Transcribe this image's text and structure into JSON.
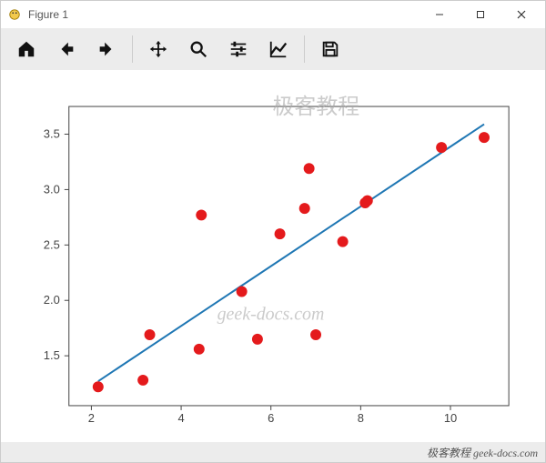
{
  "window": {
    "title": "Figure 1"
  },
  "toolbar": {
    "home": "Home",
    "back": "Back",
    "forward": "Forward",
    "pan": "Pan",
    "zoom": "Zoom",
    "configure": "Configure subplots",
    "edit": "Edit axes",
    "save": "Save"
  },
  "watermarks": {
    "top": "极客教程",
    "mid": "geek-docs.com"
  },
  "status": {
    "text": "极客教程 geek-docs.com"
  },
  "chart_data": {
    "type": "scatter",
    "title": "",
    "xlabel": "",
    "ylabel": "",
    "xlim": [
      1.5,
      11.3
    ],
    "ylim": [
      1.05,
      3.75
    ],
    "xticks": [
      2,
      4,
      6,
      8,
      10
    ],
    "yticks": [
      1.5,
      2.0,
      2.5,
      3.0,
      3.5
    ],
    "series": [
      {
        "name": "points",
        "type": "scatter",
        "color": "#e41a1c",
        "x": [
          2.15,
          3.15,
          3.3,
          4.4,
          4.45,
          5.35,
          5.7,
          6.2,
          6.75,
          6.85,
          7.0,
          7.6,
          8.1,
          8.15,
          9.8,
          10.75
        ],
        "y": [
          1.22,
          1.28,
          1.69,
          1.56,
          2.77,
          2.08,
          1.65,
          2.6,
          2.83,
          3.19,
          1.69,
          2.53,
          2.88,
          2.9,
          3.38,
          3.47
        ]
      },
      {
        "name": "fit",
        "type": "line",
        "color": "#1f77b4",
        "x": [
          2.15,
          10.75
        ],
        "y": [
          1.27,
          3.59
        ]
      }
    ]
  }
}
